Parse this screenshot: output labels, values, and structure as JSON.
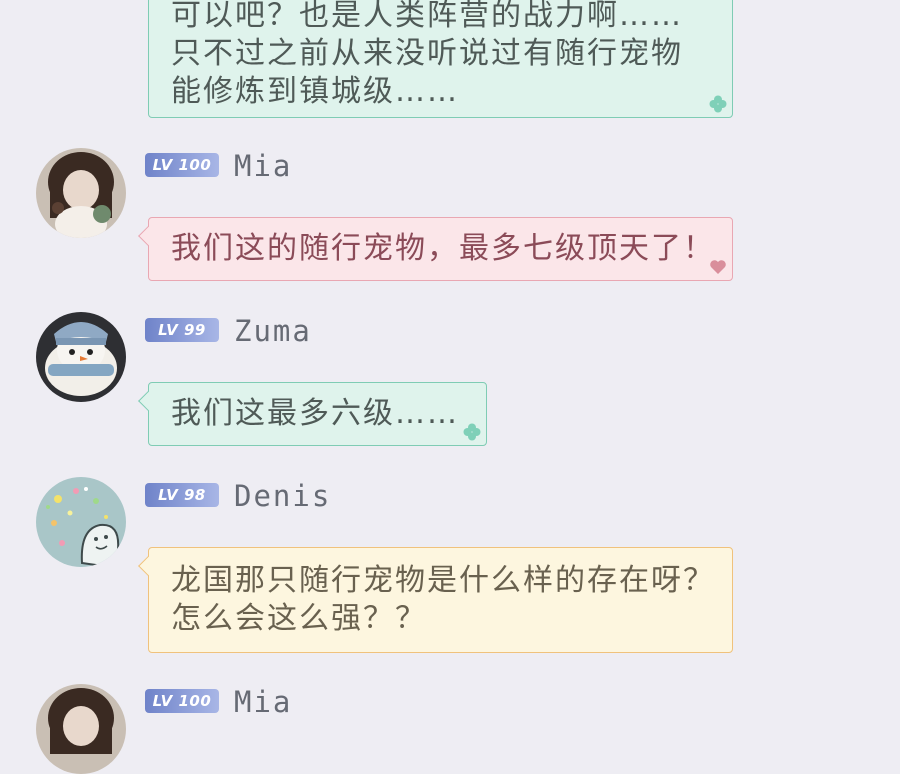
{
  "messages": [
    {
      "lines": [
        "可以吧？也是人类阵营的战力啊……",
        "只不过之前从来没听说过有随行宠物",
        "能修炼到镇城级……"
      ],
      "bubble_color": "green"
    },
    {
      "username": "Mia",
      "level": "LV 100",
      "lines": [
        "我们这的随行宠物，最多七级顶天了！"
      ],
      "bubble_color": "pink"
    },
    {
      "username": "Zuma",
      "level": "LV 99",
      "lines": [
        "我们这最多六级……"
      ],
      "bubble_color": "green"
    },
    {
      "username": "Denis",
      "level": "LV 98",
      "lines": [
        "龙国那只随行宠物是什么样的存在呀？",
        "怎么会这么强？？"
      ],
      "bubble_color": "yellow"
    },
    {
      "username": "Mia",
      "level": "LV 100"
    }
  ],
  "colors": {
    "background": "#eeedf3",
    "green_bubble": "#dff3ec",
    "pink_bubble": "#fbe6e9",
    "yellow_bubble": "#fdf6df",
    "level_badge": "#7f92d4"
  },
  "icons": {
    "green_bubble_deco": "clover-icon",
    "pink_bubble_deco": "heart-icon"
  }
}
